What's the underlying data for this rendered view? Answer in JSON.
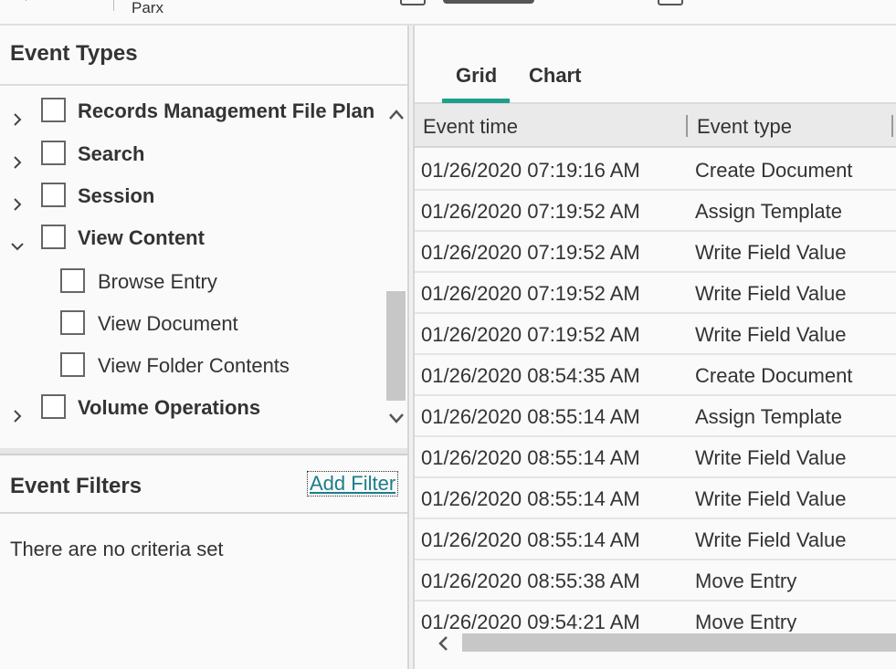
{
  "breadcrumb": {
    "current": "Parx"
  },
  "event_types": {
    "title": "Event Types",
    "items": [
      {
        "label": "Records Management File Plan",
        "expanded": false,
        "level": 0,
        "checked": false
      },
      {
        "label": "Search",
        "expanded": false,
        "level": 0,
        "checked": false
      },
      {
        "label": "Session",
        "expanded": false,
        "level": 0,
        "checked": false
      },
      {
        "label": "View Content",
        "expanded": true,
        "level": 0,
        "checked": false
      },
      {
        "label": "Browse Entry",
        "level": 1,
        "checked": false
      },
      {
        "label": "View Document",
        "level": 1,
        "checked": false
      },
      {
        "label": "View Folder Contents",
        "level": 1,
        "checked": false
      },
      {
        "label": "Volume Operations",
        "expanded": false,
        "level": 0,
        "checked": false
      }
    ]
  },
  "event_filters": {
    "title": "Event Filters",
    "add_filter_label": "Add Filter",
    "empty_message": "There are no criteria set"
  },
  "tabs": [
    {
      "label": "Grid",
      "active": true
    },
    {
      "label": "Chart",
      "active": false
    }
  ],
  "grid": {
    "columns": [
      "Event time",
      "Event type"
    ],
    "rows": [
      [
        "01/26/2020 07:19:16 AM",
        "Create Document"
      ],
      [
        "01/26/2020 07:19:52 AM",
        "Assign Template"
      ],
      [
        "01/26/2020 07:19:52 AM",
        "Write Field Value"
      ],
      [
        "01/26/2020 07:19:52 AM",
        "Write Field Value"
      ],
      [
        "01/26/2020 07:19:52 AM",
        "Write Field Value"
      ],
      [
        "01/26/2020 08:54:35 AM",
        "Create Document"
      ],
      [
        "01/26/2020 08:55:14 AM",
        "Assign Template"
      ],
      [
        "01/26/2020 08:55:14 AM",
        "Write Field Value"
      ],
      [
        "01/26/2020 08:55:14 AM",
        "Write Field Value"
      ],
      [
        "01/26/2020 08:55:14 AM",
        "Write Field Value"
      ],
      [
        "01/26/2020 08:55:38 AM",
        "Move Entry"
      ],
      [
        "01/26/2020 09:54:21 AM",
        "Move Entry"
      ]
    ]
  },
  "colors": {
    "accent": "#1f9e8c",
    "link": "#1b7e8a"
  }
}
